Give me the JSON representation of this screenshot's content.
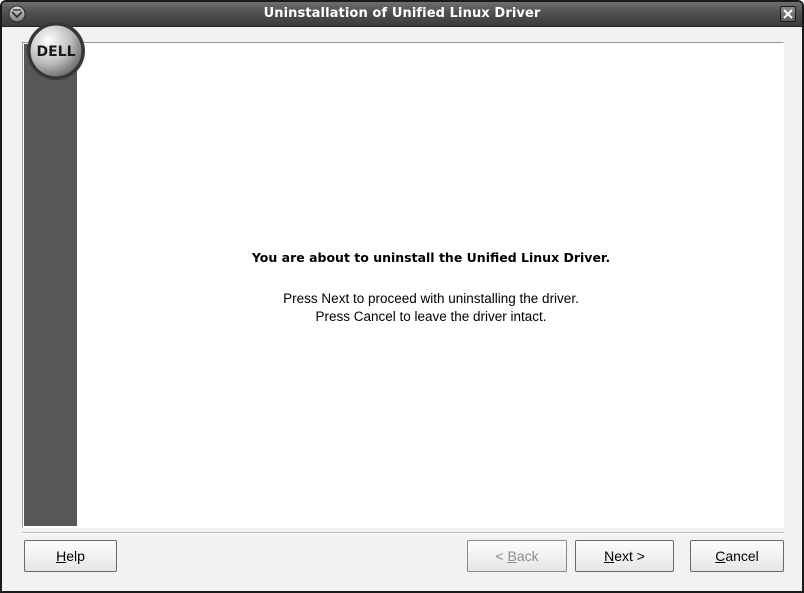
{
  "window": {
    "title": "Uninstallation of Unified Linux Driver"
  },
  "logo": {
    "text": "DELL"
  },
  "message": {
    "heading": "You are about to uninstall the Unified Linux Driver.",
    "line1": "Press Next to proceed with uninstalling the driver.",
    "line2": "Press Cancel to leave the driver intact."
  },
  "buttons": {
    "help": {
      "mnemonic": "H",
      "rest": "elp"
    },
    "back": {
      "prefix": "< ",
      "mnemonic": "B",
      "rest": "ack"
    },
    "next": {
      "mnemonic": "N",
      "rest": "ext >"
    },
    "cancel": {
      "mnemonic": "C",
      "rest": "ancel"
    }
  },
  "colors": {
    "titlebar": "#4f4f4f",
    "sidebar": "#575757",
    "logo_ring": "#3a3a3a"
  },
  "icons": {
    "app": "app-menu-icon",
    "close": "close-icon",
    "brand": "dell-logo-icon"
  }
}
